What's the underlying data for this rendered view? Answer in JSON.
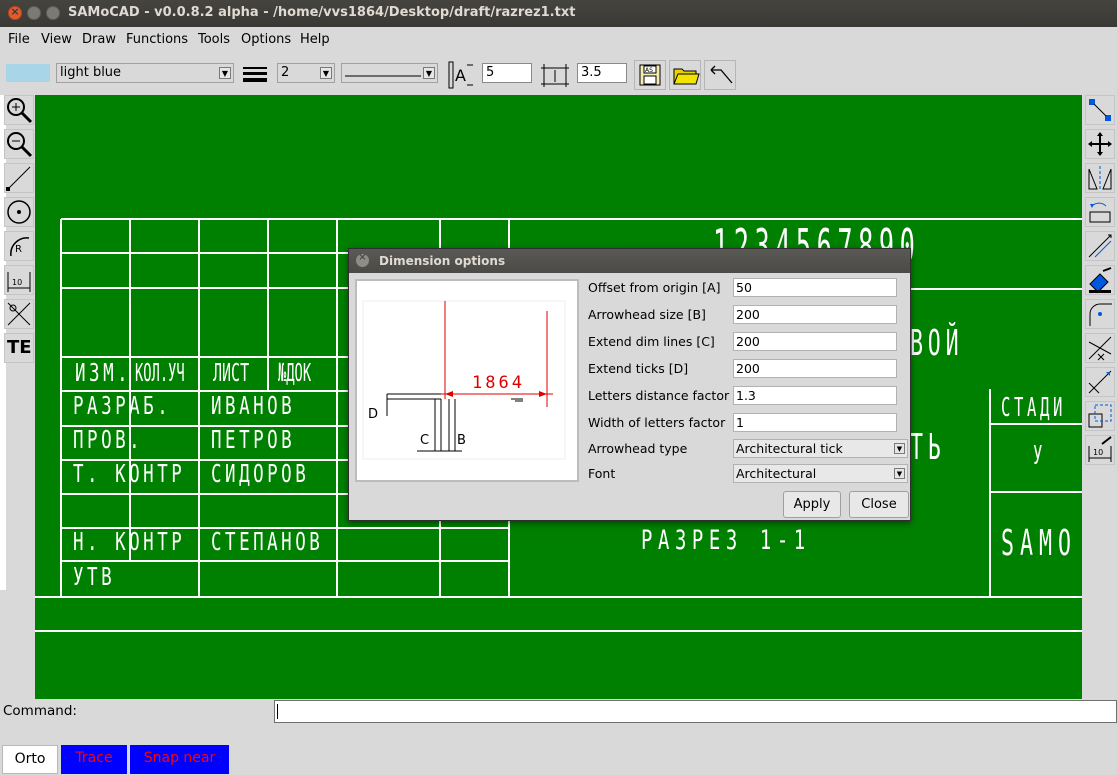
{
  "window": {
    "title": "SAMoCAD - v0.0.8.2 alpha - /home/vvs1864/Desktop/draft/razrez1.txt"
  },
  "menu": [
    "File",
    "View",
    "Draw",
    "Functions",
    "Tools",
    "Options",
    "Help"
  ],
  "toolbar": {
    "color_value": "light blue",
    "color_swatch": "#a8d6e8",
    "line_width": "2",
    "line_style": "",
    "text_size_value": "5",
    "dim_size_value": "3.5",
    "icons": [
      "text-size-icon",
      "dimension-size-icon",
      "save-icon",
      "open-folder-icon",
      "undo-icon"
    ]
  },
  "left_tools": [
    "zoom-in-icon",
    "zoom-out-icon",
    "line-icon",
    "circle-icon",
    "arc-icon",
    "dimension-icon",
    "trim-icon",
    "text-icon"
  ],
  "left_tools_text": {
    "text_tool": "TE"
  },
  "right_tools": [
    "copy-icon",
    "move-icon",
    "mirror-icon",
    "rotate-icon",
    "offset-icon",
    "paint-icon",
    "fillet-icon",
    "trim-icon",
    "extend-icon",
    "scale-icon",
    "edit-dimension-icon"
  ],
  "drawing": {
    "background": "#008000",
    "digits": "1234567890",
    "header_row": [
      "ИЗМ.",
      "КОЛ.УЧ",
      "ЛИСТ",
      "№ДОК"
    ],
    "rows": [
      {
        "role": "РАЗРАБ.",
        "name": "ИВАНОВ"
      },
      {
        "role": "ПРОВ.",
        "name": "ПЕТРОВ"
      },
      {
        "role": "Т. КОНТР",
        "name": "СИДОРОВ"
      },
      {
        "role": "",
        "name": ""
      },
      {
        "role": "Н. КОНТР",
        "name": "СТЕПАНОВ"
      },
      {
        "role": "УТВ",
        "name": ""
      }
    ],
    "title": "РАЗРЕЗ 1-1",
    "partial_1": "ВОЙ",
    "partial_2": "ТЬ",
    "stage_label": "СТАДИ",
    "stage_value": "У",
    "company": "SAMO"
  },
  "dialog": {
    "title": "Dimension options",
    "preview": {
      "dim_value": "1864",
      "labels": [
        "D",
        "C",
        "B"
      ]
    },
    "fields": [
      {
        "label": "Offset from origin [A]",
        "value": "50"
      },
      {
        "label": "Arrowhead size [B]",
        "value": "200"
      },
      {
        "label": "Extend dim lines [C]",
        "value": "200"
      },
      {
        "label": "Extend ticks [D]",
        "value": "200"
      },
      {
        "label": "Letters distance factor",
        "value": "1.3"
      },
      {
        "label": "Width of letters factor",
        "value": "1"
      }
    ],
    "selects": [
      {
        "label": "Arrowhead type",
        "value": "Architectural tick"
      },
      {
        "label": "Font",
        "value": "Architectural"
      }
    ],
    "apply_label": "Apply",
    "close_label": "Close"
  },
  "command": {
    "label": "Command:",
    "value": ""
  },
  "status": {
    "orto": "Orto",
    "trace": "Trace",
    "snap": "Snap near"
  }
}
